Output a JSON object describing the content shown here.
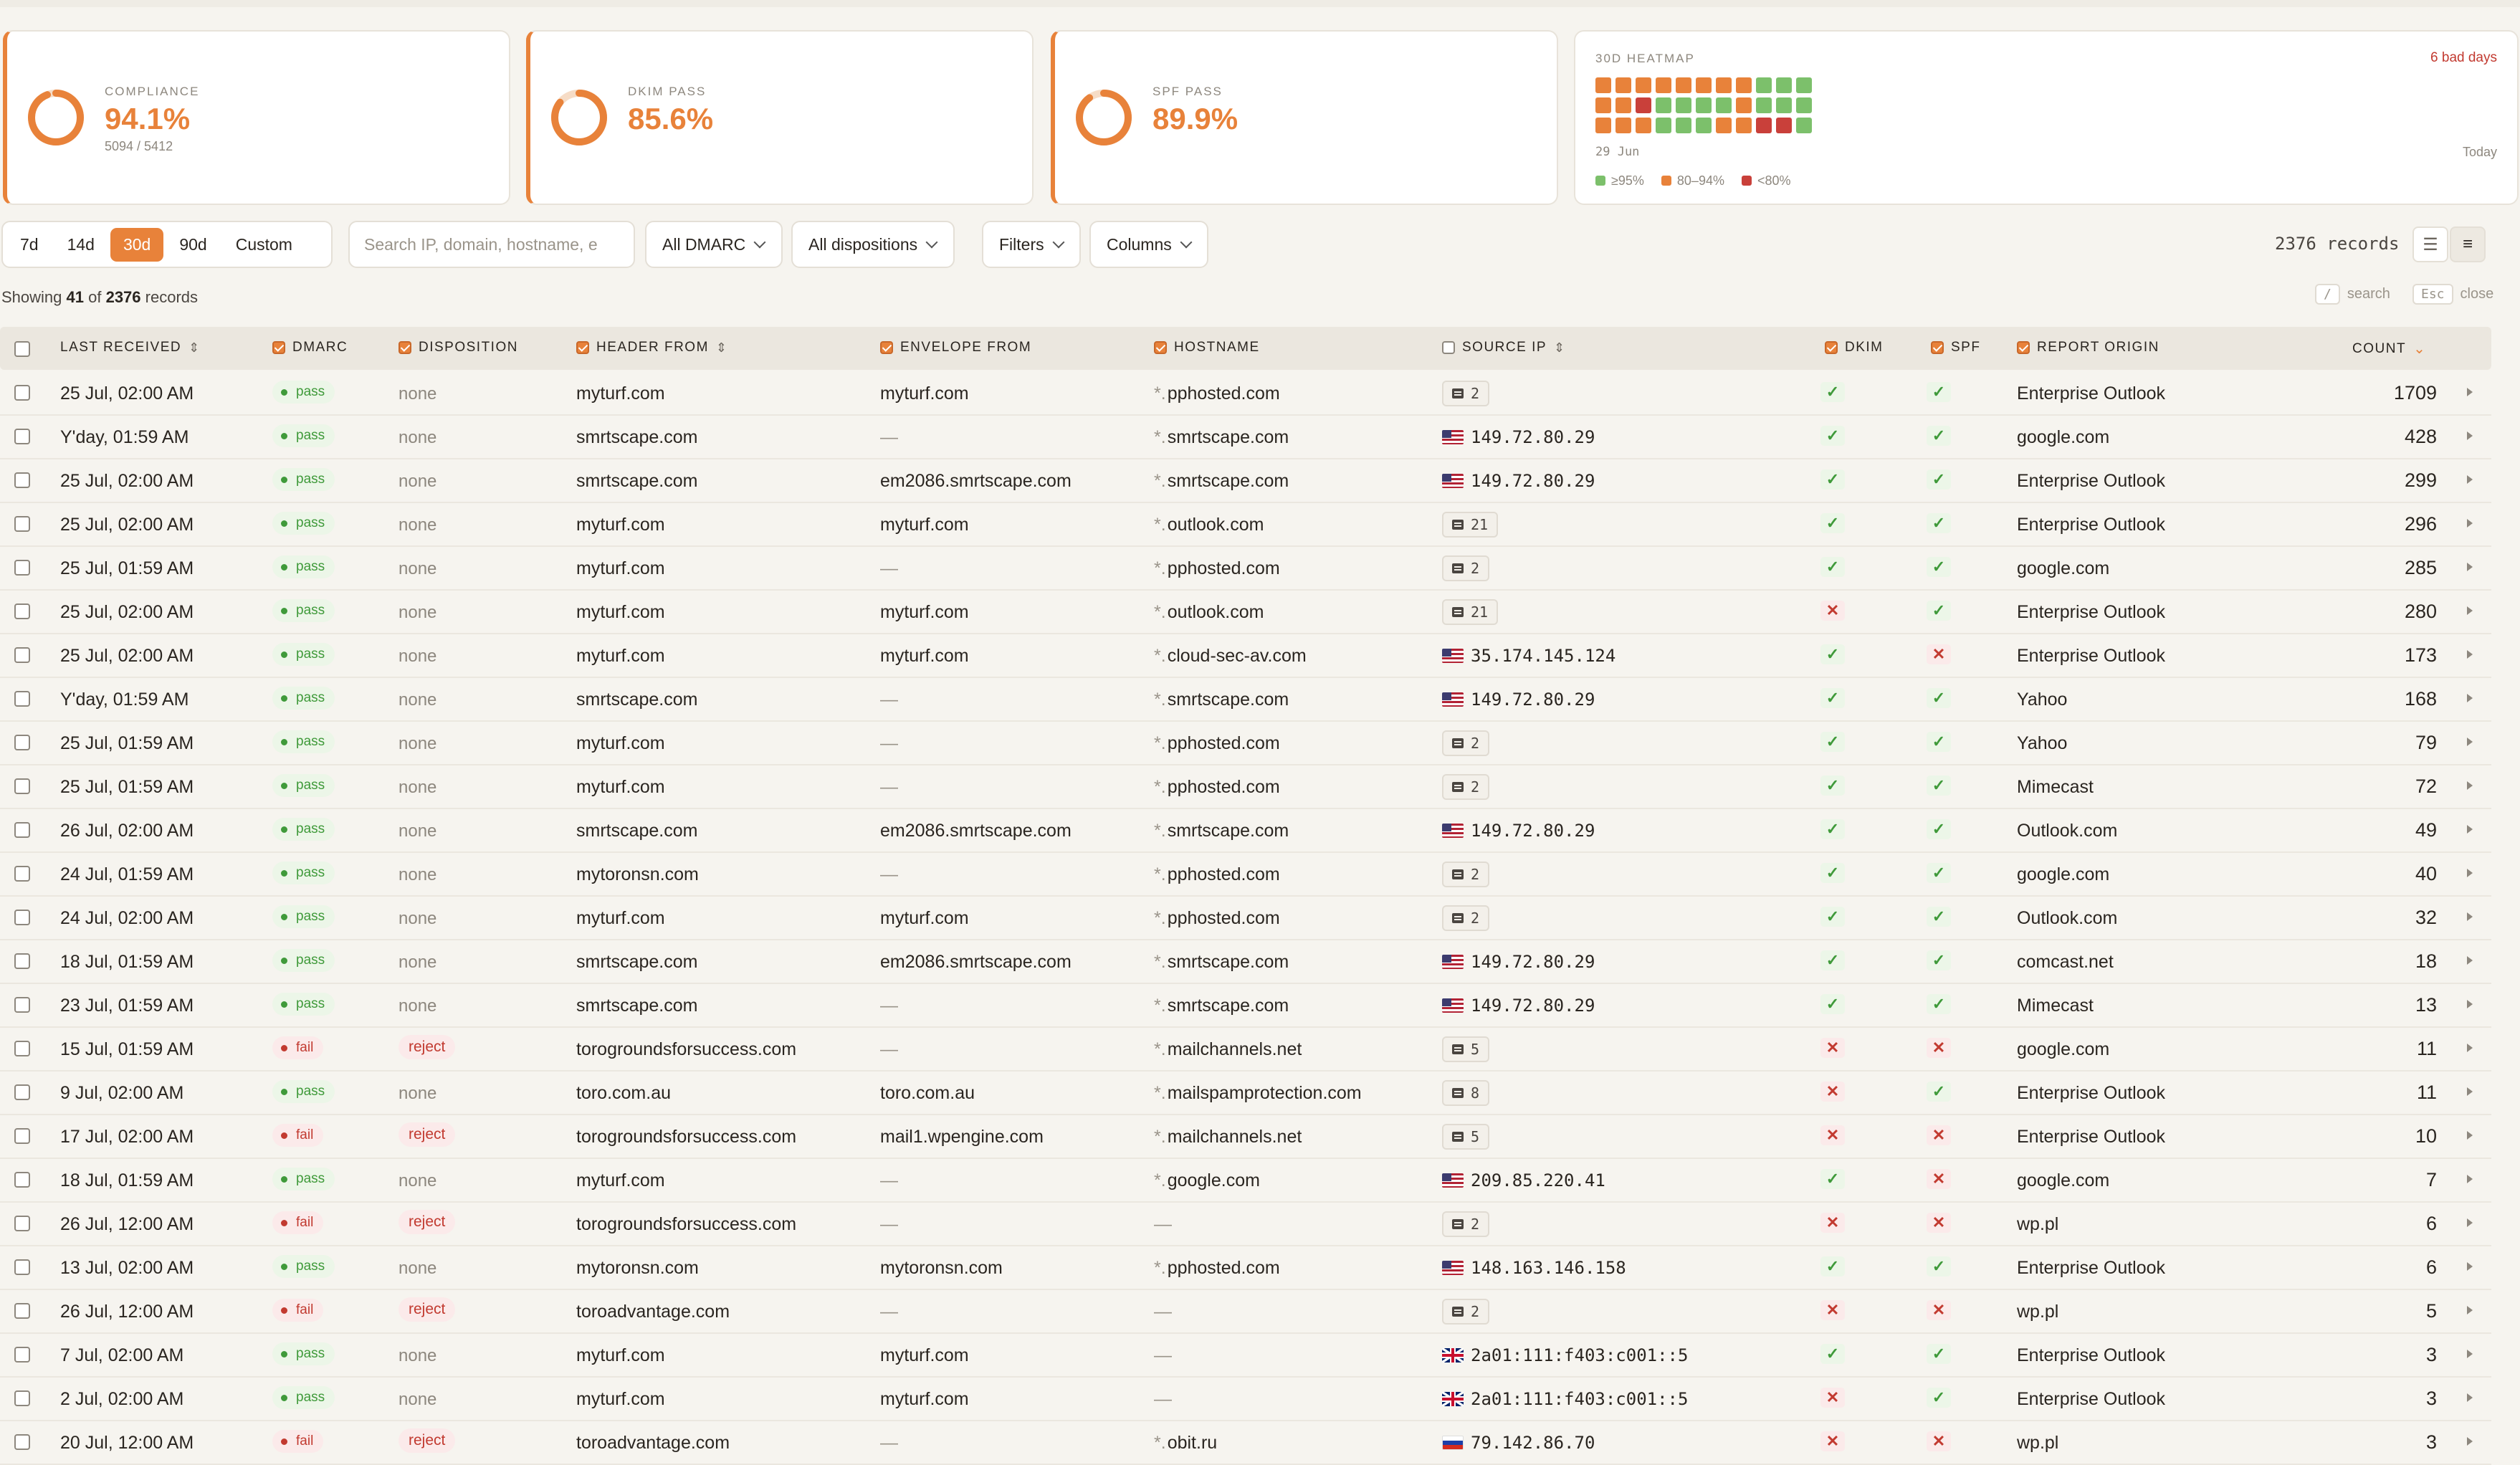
{
  "kpis": [
    {
      "label": "COMPLIANCE",
      "value": "94.1%",
      "sub": "5094 / 5412",
      "pct": 0.941
    },
    {
      "label": "DKIM PASS",
      "value": "85.6%",
      "sub": "",
      "pct": 0.856
    },
    {
      "label": "SPF PASS",
      "value": "89.9%",
      "sub": "",
      "pct": 0.899
    }
  ],
  "heatmap": {
    "title": "30D HEATMAP",
    "bad_days": "6 bad days",
    "start_label": "29 Jun",
    "end_label": "Today",
    "legend": [
      {
        "label": "≥95%",
        "color": "#7cc06b"
      },
      {
        "label": "80–94%",
        "color": "#e8823a"
      },
      {
        "label": "<80%",
        "color": "#c9403a"
      }
    ],
    "cells": [
      "o",
      "o",
      "o",
      "o",
      "o",
      "o",
      "o",
      "o",
      "g",
      "g",
      "g",
      "o",
      "o",
      "r",
      "g",
      "g",
      "g",
      "g",
      "o",
      "g",
      "g",
      "g",
      "o",
      "o",
      "o",
      "g",
      "g",
      "g",
      "o",
      "o",
      "r",
      "r",
      "g"
    ]
  },
  "toolbar": {
    "ranges": [
      "7d",
      "14d",
      "30d",
      "90d",
      "Custom"
    ],
    "active_range": "30d",
    "search_placeholder": "Search IP, domain, hostname, e",
    "dmarc_filter": "All DMARC",
    "disposition_filter": "All dispositions",
    "filters_label": "Filters",
    "columns_label": "Columns",
    "record_count": "2376 records"
  },
  "status": {
    "prefix": "Showing ",
    "shown": "41",
    "mid": " of ",
    "total": "2376",
    "suffix": " records"
  },
  "shortcuts": [
    {
      "key": "/",
      "label": "search"
    },
    {
      "key": "Esc",
      "label": "close"
    }
  ],
  "columns": {
    "last_received": "LAST RECEIVED",
    "dmarc": "DMARC",
    "disposition": "DISPOSITION",
    "header_from": "HEADER FROM",
    "envelope_from": "ENVELOPE FROM",
    "hostname": "HOSTNAME",
    "source_ip": "SOURCE IP",
    "dkim": "DKIM",
    "spf": "SPF",
    "report_origin": "REPORT ORIGIN",
    "count": "COUNT"
  },
  "rows": [
    {
      "received": "25 Jul, 02:00 AM",
      "dmarc": "pass",
      "disp": "none",
      "header": "myturf.com",
      "envelope": "myturf.com",
      "host": "pphosted.com",
      "ipCount": "2",
      "dkim": true,
      "spf": true,
      "origin": "Enterprise Outlook",
      "count": "1709"
    },
    {
      "received": "Y'day, 01:59 AM",
      "dmarc": "pass",
      "disp": "none",
      "header": "smrtscape.com",
      "envelope": "—",
      "host": "smrtscape.com",
      "ip": "149.72.80.29",
      "flag": "us",
      "dkim": true,
      "spf": true,
      "origin": "google.com",
      "count": "428"
    },
    {
      "received": "25 Jul, 02:00 AM",
      "dmarc": "pass",
      "disp": "none",
      "header": "smrtscape.com",
      "envelope": "em2086.smrtscape.com",
      "host": "smrtscape.com",
      "ip": "149.72.80.29",
      "flag": "us",
      "dkim": true,
      "spf": true,
      "origin": "Enterprise Outlook",
      "count": "299"
    },
    {
      "received": "25 Jul, 02:00 AM",
      "dmarc": "pass",
      "disp": "none",
      "header": "myturf.com",
      "envelope": "myturf.com",
      "host": "outlook.com",
      "ipCount": "21",
      "dkim": true,
      "spf": true,
      "origin": "Enterprise Outlook",
      "count": "296"
    },
    {
      "received": "25 Jul, 01:59 AM",
      "dmarc": "pass",
      "disp": "none",
      "header": "myturf.com",
      "envelope": "—",
      "host": "pphosted.com",
      "ipCount": "2",
      "dkim": true,
      "spf": true,
      "origin": "google.com",
      "count": "285"
    },
    {
      "received": "25 Jul, 02:00 AM",
      "dmarc": "pass",
      "disp": "none",
      "header": "myturf.com",
      "envelope": "myturf.com",
      "host": "outlook.com",
      "ipCount": "21",
      "dkim": false,
      "spf": true,
      "origin": "Enterprise Outlook",
      "count": "280"
    },
    {
      "received": "25 Jul, 02:00 AM",
      "dmarc": "pass",
      "disp": "none",
      "header": "myturf.com",
      "envelope": "myturf.com",
      "host": "cloud-sec-av.com",
      "ip": "35.174.145.124",
      "flag": "us",
      "dkim": true,
      "spf": false,
      "origin": "Enterprise Outlook",
      "count": "173"
    },
    {
      "received": "Y'day, 01:59 AM",
      "dmarc": "pass",
      "disp": "none",
      "header": "smrtscape.com",
      "envelope": "—",
      "host": "smrtscape.com",
      "ip": "149.72.80.29",
      "flag": "us",
      "dkim": true,
      "spf": true,
      "origin": "Yahoo",
      "count": "168"
    },
    {
      "received": "25 Jul, 01:59 AM",
      "dmarc": "pass",
      "disp": "none",
      "header": "myturf.com",
      "envelope": "—",
      "host": "pphosted.com",
      "ipCount": "2",
      "dkim": true,
      "spf": true,
      "origin": "Yahoo",
      "count": "79"
    },
    {
      "received": "25 Jul, 01:59 AM",
      "dmarc": "pass",
      "disp": "none",
      "header": "myturf.com",
      "envelope": "—",
      "host": "pphosted.com",
      "ipCount": "2",
      "dkim": true,
      "spf": true,
      "origin": "Mimecast",
      "count": "72"
    },
    {
      "received": "26 Jul, 02:00 AM",
      "dmarc": "pass",
      "disp": "none",
      "header": "smrtscape.com",
      "envelope": "em2086.smrtscape.com",
      "host": "smrtscape.com",
      "ip": "149.72.80.29",
      "flag": "us",
      "dkim": true,
      "spf": true,
      "origin": "Outlook.com",
      "count": "49"
    },
    {
      "received": "24 Jul, 01:59 AM",
      "dmarc": "pass",
      "disp": "none",
      "header": "mytoronsn.com",
      "envelope": "—",
      "host": "pphosted.com",
      "ipCount": "2",
      "dkim": true,
      "spf": true,
      "origin": "google.com",
      "count": "40"
    },
    {
      "received": "24 Jul, 02:00 AM",
      "dmarc": "pass",
      "disp": "none",
      "header": "myturf.com",
      "envelope": "myturf.com",
      "host": "pphosted.com",
      "ipCount": "2",
      "dkim": true,
      "spf": true,
      "origin": "Outlook.com",
      "count": "32"
    },
    {
      "received": "18 Jul, 01:59 AM",
      "dmarc": "pass",
      "disp": "none",
      "header": "smrtscape.com",
      "envelope": "em2086.smrtscape.com",
      "host": "smrtscape.com",
      "ip": "149.72.80.29",
      "flag": "us",
      "dkim": true,
      "spf": true,
      "origin": "comcast.net",
      "count": "18"
    },
    {
      "received": "23 Jul, 01:59 AM",
      "dmarc": "pass",
      "disp": "none",
      "header": "smrtscape.com",
      "envelope": "—",
      "host": "smrtscape.com",
      "ip": "149.72.80.29",
      "flag": "us",
      "dkim": true,
      "spf": true,
      "origin": "Mimecast",
      "count": "13"
    },
    {
      "received": "15 Jul, 01:59 AM",
      "dmarc": "fail",
      "disp": "reject",
      "header": "torogroundsforsuccess.com",
      "envelope": "—",
      "host": "mailchannels.net",
      "ipCount": "5",
      "dkim": false,
      "spf": false,
      "origin": "google.com",
      "count": "11"
    },
    {
      "received": "9 Jul, 02:00 AM",
      "dmarc": "pass",
      "disp": "none",
      "header": "toro.com.au",
      "envelope": "toro.com.au",
      "host": "mailspamprotection.com",
      "ipCount": "8",
      "dkim": false,
      "spf": true,
      "origin": "Enterprise Outlook",
      "count": "11"
    },
    {
      "received": "17 Jul, 02:00 AM",
      "dmarc": "fail",
      "disp": "reject",
      "header": "torogroundsforsuccess.com",
      "envelope": "mail1.wpengine.com",
      "host": "mailchannels.net",
      "ipCount": "5",
      "dkim": false,
      "spf": false,
      "origin": "Enterprise Outlook",
      "count": "10"
    },
    {
      "received": "18 Jul, 01:59 AM",
      "dmarc": "pass",
      "disp": "none",
      "header": "myturf.com",
      "envelope": "—",
      "host": "google.com",
      "ip": "209.85.220.41",
      "flag": "us",
      "dkim": true,
      "spf": false,
      "origin": "google.com",
      "count": "7"
    },
    {
      "received": "26 Jul, 12:00 AM",
      "dmarc": "fail",
      "disp": "reject",
      "header": "torogroundsforsuccess.com",
      "envelope": "—",
      "host": "—",
      "ipCount": "2",
      "dkim": false,
      "spf": false,
      "origin": "wp.pl",
      "count": "6"
    },
    {
      "received": "13 Jul, 02:00 AM",
      "dmarc": "pass",
      "disp": "none",
      "header": "mytoronsn.com",
      "envelope": "mytoronsn.com",
      "host": "pphosted.com",
      "ip": "148.163.146.158",
      "flag": "us",
      "dkim": true,
      "spf": true,
      "origin": "Enterprise Outlook",
      "count": "6"
    },
    {
      "received": "26 Jul, 12:00 AM",
      "dmarc": "fail",
      "disp": "reject",
      "header": "toroadvantage.com",
      "envelope": "—",
      "host": "—",
      "ipCount": "2",
      "dkim": false,
      "spf": false,
      "origin": "wp.pl",
      "count": "5"
    },
    {
      "received": "7 Jul, 02:00 AM",
      "dmarc": "pass",
      "disp": "none",
      "header": "myturf.com",
      "envelope": "myturf.com",
      "host": "—",
      "ip": "2a01:111:f403:c001::5",
      "flag": "gb",
      "dkim": true,
      "spf": true,
      "origin": "Enterprise Outlook",
      "count": "3"
    },
    {
      "received": "2 Jul, 02:00 AM",
      "dmarc": "pass",
      "disp": "none",
      "header": "myturf.com",
      "envelope": "myturf.com",
      "host": "—",
      "ip": "2a01:111:f403:c001::5",
      "flag": "gb",
      "dkim": false,
      "spf": true,
      "origin": "Enterprise Outlook",
      "count": "3"
    },
    {
      "received": "20 Jul, 12:00 AM",
      "dmarc": "fail",
      "disp": "reject",
      "header": "toroadvantage.com",
      "envelope": "—",
      "host": "obit.ru",
      "ip": "79.142.86.70",
      "flag": "ru",
      "dkim": false,
      "spf": false,
      "origin": "wp.pl",
      "count": "3"
    }
  ]
}
